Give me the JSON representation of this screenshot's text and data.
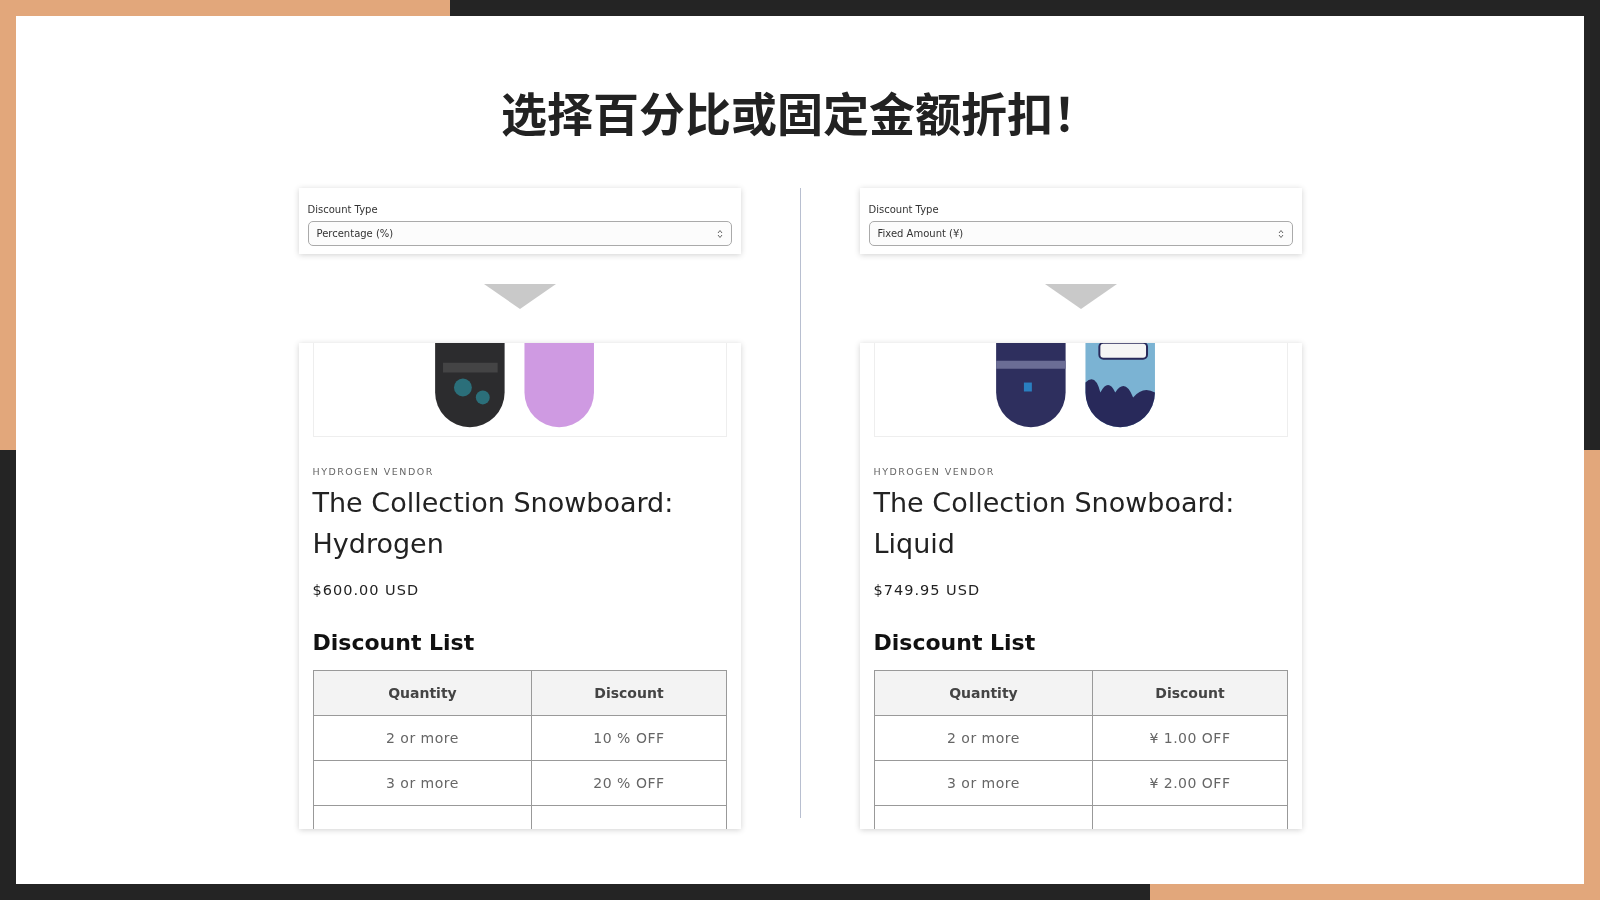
{
  "title": "选择百分比或固定金额折扣！",
  "panels": [
    {
      "discount_type": {
        "label": "Discount Type",
        "value": "Percentage (%)"
      },
      "product": {
        "vendor": "HYDROGEN VENDOR",
        "title": "The Collection Snowboard: Hydrogen",
        "price": "$600.00 USD",
        "discount_list": {
          "heading": "Discount List",
          "columns": [
            "Quantity",
            "Discount"
          ],
          "rows": [
            [
              "2 or more",
              "10 % OFF"
            ],
            [
              "3 or more",
              "20 % OFF"
            ]
          ]
        }
      }
    },
    {
      "discount_type": {
        "label": "Discount Type",
        "value": "Fixed Amount (¥)"
      },
      "product": {
        "vendor": "HYDROGEN VENDOR",
        "title": "The Collection Snowboard: Liquid",
        "price": "$749.95 USD",
        "discount_list": {
          "heading": "Discount List",
          "columns": [
            "Quantity",
            "Discount"
          ],
          "rows": [
            [
              "2 or more",
              "¥ 1.00 OFF"
            ],
            [
              "3 or more",
              "¥ 2.00 OFF"
            ]
          ]
        }
      }
    }
  ]
}
